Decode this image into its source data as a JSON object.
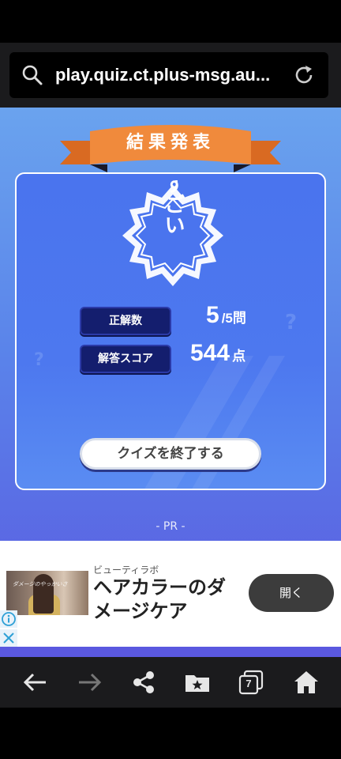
{
  "browser": {
    "url": "play.quiz.ct.plus-msg.au..."
  },
  "result": {
    "ribbon_title": "結果発表",
    "badge_text": "すごい",
    "correct_label": "正解数",
    "correct_value": "5",
    "correct_total": "/5問",
    "score_label": "解答スコア",
    "score_value": "544",
    "score_unit": "点",
    "end_button_label": "クイズを終了する"
  },
  "ad": {
    "pr_label": "- PR -",
    "sponsor": "ビューティラボ",
    "headline": "ヘアカラーのダメージケア",
    "open_button_label": "開く",
    "image_text": "ダメージのやっかいさ"
  },
  "toolbar": {
    "tab_count": "7"
  },
  "colors": {
    "page_top": "#6aa3ee",
    "page_bottom": "#5b59e0",
    "ribbon": "#f08a3c",
    "label_bg": "#141e6e"
  }
}
